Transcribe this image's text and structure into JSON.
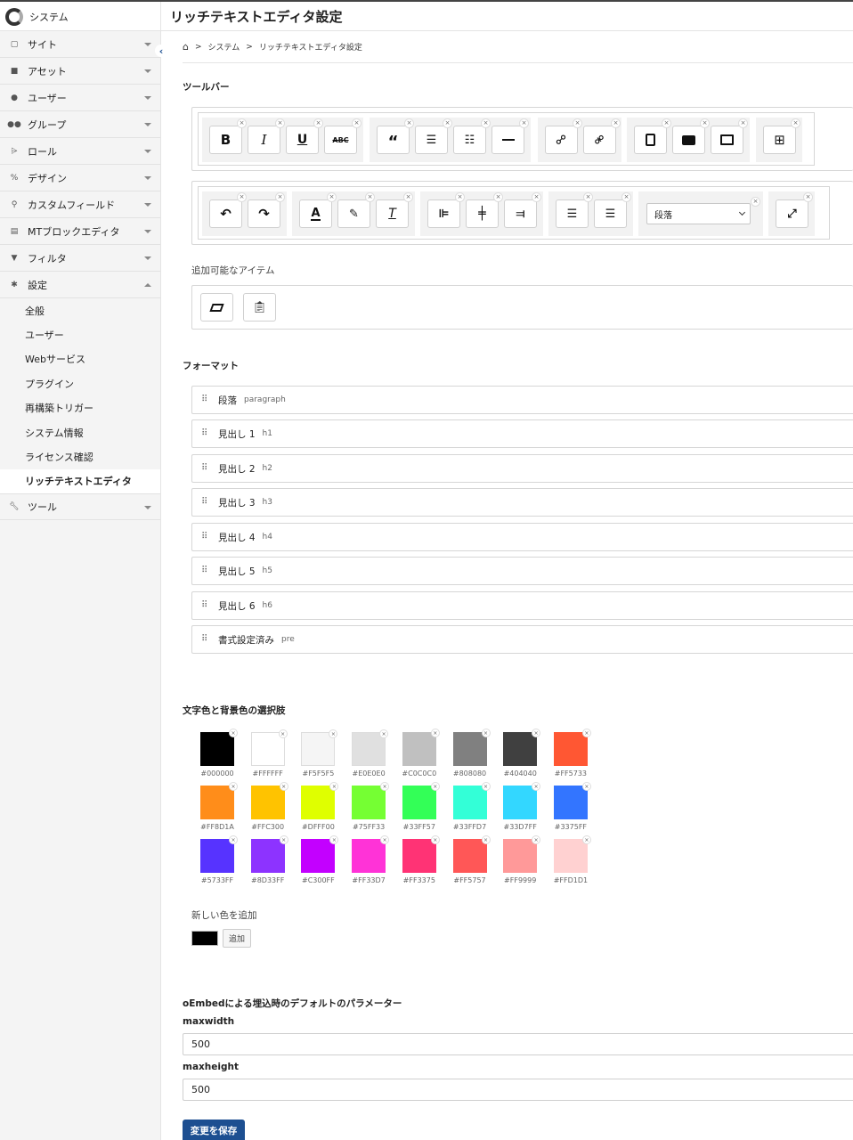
{
  "header": {
    "brand": "システム",
    "title": "リッチテキストエディタ設定"
  },
  "sidebar": {
    "items": [
      {
        "label": "サイト",
        "icon": "site-icon"
      },
      {
        "label": "アセット",
        "icon": "asset-icon"
      },
      {
        "label": "ユーザー",
        "icon": "user-icon"
      },
      {
        "label": "グループ",
        "icon": "group-icon"
      },
      {
        "label": "ロール",
        "icon": "role-icon"
      },
      {
        "label": "デザイン",
        "icon": "design-icon"
      },
      {
        "label": "カスタムフィールド",
        "icon": "custom-field-icon"
      },
      {
        "label": "MTブロックエディタ",
        "icon": "block-editor-icon"
      },
      {
        "label": "フィルタ",
        "icon": "filter-icon"
      },
      {
        "label": "設定",
        "icon": "settings-icon"
      }
    ],
    "sub_items": [
      "全般",
      "ユーザー",
      "Webサービス",
      "プラグイン",
      "再構築トリガー",
      "システム情報",
      "ライセンス確認",
      "リッチテキストエディタ"
    ],
    "tools": {
      "label": "ツール",
      "icon": "wrench-icon"
    }
  },
  "breadcrumb": {
    "home": "home-icon",
    "system": "システム",
    "current": "リッチテキストエディタ設定",
    "sep": ">"
  },
  "toolbar": {
    "heading": "ツールバー",
    "block_format_value": "段落",
    "available_label": "追加可能なアイテム",
    "row1_icons": [
      "bold-icon",
      "italic-icon",
      "underline-icon",
      "strikethrough-icon",
      "blockquote-icon",
      "bullet-list-icon",
      "numbered-list-icon",
      "horizontal-rule-icon",
      "link-icon",
      "unlink-icon",
      "insert-file-icon",
      "insert-asset-icon",
      "insert-image-icon",
      "table-icon"
    ],
    "row2_icons": [
      "undo-icon",
      "redo-icon",
      "text-color-icon",
      "highlight-icon",
      "clear-format-icon",
      "align-left-icon",
      "align-center-icon",
      "align-right-icon",
      "indent-icon",
      "outdent-icon",
      "fullscreen-icon"
    ],
    "available_icons": [
      "paste-as-text-icon",
      "paste-icon"
    ]
  },
  "format": {
    "heading": "フォーマット",
    "items": [
      {
        "name": "段落",
        "tag": "paragraph"
      },
      {
        "name": "見出し 1",
        "tag": "h1"
      },
      {
        "name": "見出し 2",
        "tag": "h2"
      },
      {
        "name": "見出し 3",
        "tag": "h3"
      },
      {
        "name": "見出し 4",
        "tag": "h4"
      },
      {
        "name": "見出し 5",
        "tag": "h5"
      },
      {
        "name": "見出し 6",
        "tag": "h6"
      },
      {
        "name": "書式設定済み",
        "tag": "pre"
      }
    ]
  },
  "colors": {
    "heading": "文字色と背景色の選択肢",
    "swatches": [
      "#000000",
      "#FFFFFF",
      "#F5F5F5",
      "#E0E0E0",
      "#C0C0C0",
      "#808080",
      "#404040",
      "#FF5733",
      "#FF8D1A",
      "#FFC300",
      "#DFFF00",
      "#75FF33",
      "#33FF57",
      "#33FFD7",
      "#33D7FF",
      "#3375FF",
      "#5733FF",
      "#8D33FF",
      "#C300FF",
      "#FF33D7",
      "#FF3375",
      "#FF5757",
      "#FF9999",
      "#FFD1D1"
    ],
    "add_label": "新しい色を追加",
    "add_button": "追加",
    "new_color": "#000000"
  },
  "oembed": {
    "heading": "oEmbedによる埋込時のデフォルトのパラメーター",
    "maxwidth_label": "maxwidth",
    "maxwidth_value": "500",
    "maxheight_label": "maxheight",
    "maxheight_value": "500"
  },
  "save_button": "変更を保存"
}
